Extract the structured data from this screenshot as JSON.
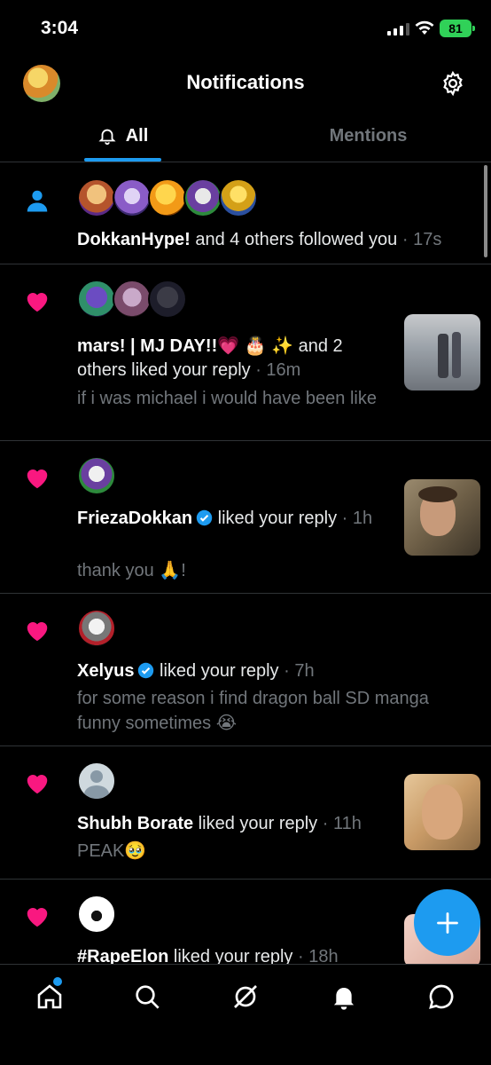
{
  "status_bar": {
    "time": "3:04",
    "battery": "81"
  },
  "header": {
    "title": "Notifications"
  },
  "tabs": [
    {
      "label": "All",
      "active": true
    },
    {
      "label": "Mentions",
      "active": false
    }
  ],
  "notifications": [
    {
      "type": "follow",
      "actor": "DokkanHype!",
      "action": " and 4 others followed you",
      "time": " · 17s"
    },
    {
      "type": "like",
      "actor": "mars! | MJ DAY!!💗 🎂 ✨",
      "action": " and 2 others liked your reply",
      "time": " · 16m",
      "snippet": "if i was michael i would have been like"
    },
    {
      "type": "like",
      "actor": "FriezaDokkan",
      "verified": true,
      "action": " liked your reply",
      "time": " · 1h",
      "snippet": "thank you 🙏!"
    },
    {
      "type": "like",
      "actor": "Xelyus",
      "verified": true,
      "action": " liked your reply",
      "time": " · 7h",
      "snippet": "for some reason i find dragon ball SD manga funny sometimes 😭"
    },
    {
      "type": "like",
      "actor": "Shubh Borate",
      "action": " liked your reply",
      "time": " · 11h",
      "snippet": "PEAK🥹"
    },
    {
      "type": "like",
      "actor": "#RapeElon",
      "action": " liked your reply",
      "time": " · 18h"
    }
  ],
  "colors": {
    "accent": "#1d9bf0",
    "like": "#f91880",
    "background": "#000000"
  },
  "icons": [
    "settings-gear-icon",
    "bell-icon",
    "person-icon",
    "heart-icon",
    "verified-badge-icon",
    "plus-icon",
    "home-icon",
    "search-icon",
    "grok-icon",
    "notifications-bell-icon",
    "messages-icon"
  ]
}
